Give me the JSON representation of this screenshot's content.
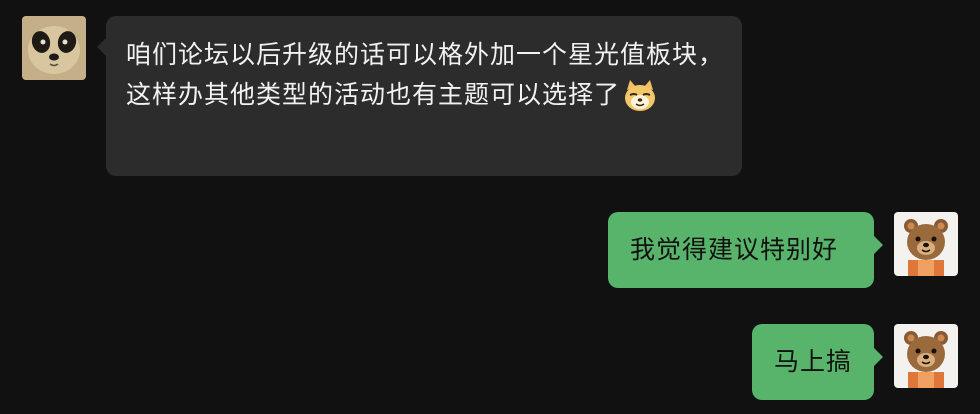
{
  "conversation": {
    "messages": [
      {
        "sender": "other",
        "avatar_icon": "panda-avatar",
        "text": "咱们论坛以后升级的话可以格外加一个星光值板块，这样办其他类型的活动也有主题可以选择了",
        "emoji": "doge-emoji"
      },
      {
        "sender": "self",
        "avatar_icon": "bear-avatar",
        "text": "我觉得建议特别好"
      },
      {
        "sender": "self",
        "avatar_icon": "bear-avatar",
        "text": "马上搞"
      }
    ]
  },
  "colors": {
    "background": "#111111",
    "incoming_bubble": "#2c2c2c",
    "outgoing_bubble": "#57b46a"
  }
}
